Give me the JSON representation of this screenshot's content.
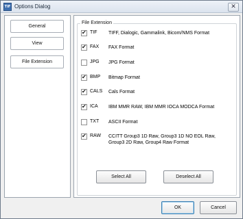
{
  "window": {
    "title": "Options Dialog",
    "icon": "TIF",
    "close_label": "✕"
  },
  "nav": {
    "items": [
      {
        "label": "General"
      },
      {
        "label": "View"
      },
      {
        "label": "File Extension"
      }
    ]
  },
  "group": {
    "legend": "File Extension"
  },
  "extensions": [
    {
      "code": "TIF",
      "description": "TIFF, Dialogic, Gammalink, Bicom/NMS Format",
      "checked": true
    },
    {
      "code": "FAX",
      "description": "FAX Format",
      "checked": true
    },
    {
      "code": "JPG",
      "description": "JPG Format",
      "checked": false
    },
    {
      "code": "BMP",
      "description": "Bitmap Format",
      "checked": true
    },
    {
      "code": "CALS",
      "description": "Cals Format",
      "checked": true
    },
    {
      "code": "ICA",
      "description": "IBM MMR RAW, IBM MMR IOCA MODCA Format",
      "checked": true
    },
    {
      "code": "TXT",
      "description": "ASCII Format",
      "checked": false
    },
    {
      "code": "RAW",
      "description": "CCITT Group3 1D Raw, Group3 1D NO EOL Raw, Group3 2D Raw, Group4 Raw Format",
      "checked": true
    }
  ],
  "buttons": {
    "select_all": "Select All",
    "deselect_all": "Deselect All",
    "ok": "OK",
    "cancel": "Cancel"
  },
  "check_glyph": "✔"
}
